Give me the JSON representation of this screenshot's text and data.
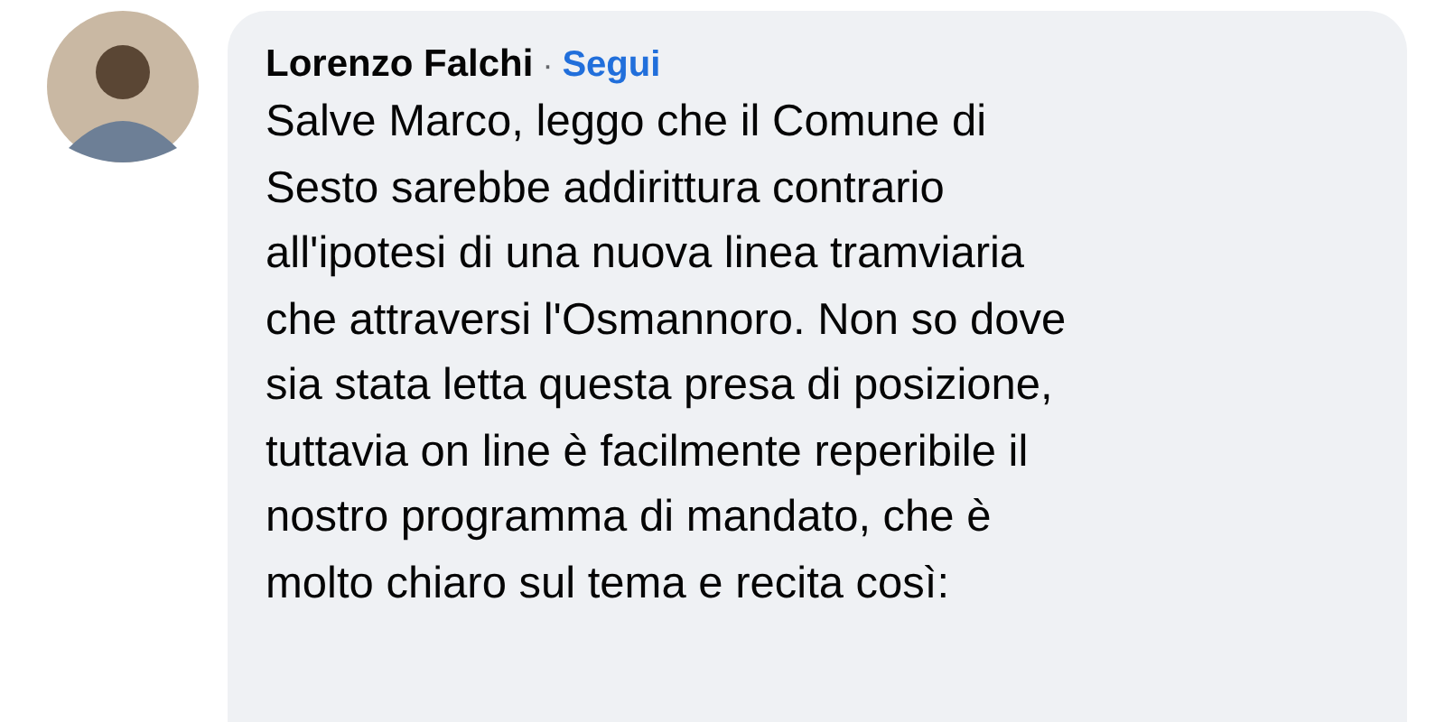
{
  "comment": {
    "author": "Lorenzo Falchi",
    "separator": "·",
    "follow": "Segui",
    "text": "Salve Marco, leggo che il Comune di\nSesto sarebbe addirittura contrario\nall'ipotesi di una nuova linea tramviaria\nche attraversi l'Osmannoro. Non so dove\nsia stata letta questa presa di posizione,\ntuttavia on line è facilmente reperibile il\nnostro programma di mandato, che è\nmolto chiaro sul tema e recita così:"
  }
}
